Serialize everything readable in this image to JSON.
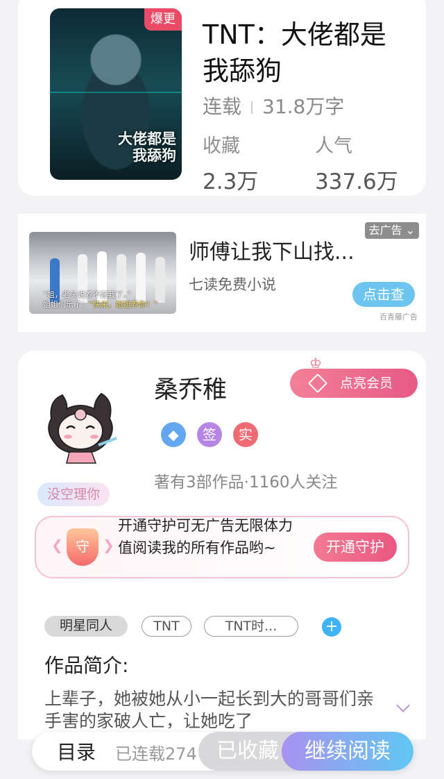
{
  "book": {
    "cover_badge": "爆更",
    "cover_title": "大佬都是我舔狗",
    "title": "TNT：大佬都是我舔狗",
    "status": "连载",
    "word_count": "31.8万字",
    "favorites_label": "收藏",
    "favorites_value": "2.3万",
    "popularity_label": "人气",
    "popularity_value": "337.6万"
  },
  "ad": {
    "title": "师傅让我下山找...",
    "source": "七读免费小说",
    "close_label": "去广告 ⌄",
    "cta_label": "点击查",
    "mark": "百青藤广告",
    "image_caption_1": "“姐，老头说养不起我了。”",
    "image_caption_2a": "姐姐们乐了：",
    "image_caption_2b": "“快来，姐姐养你！”"
  },
  "author": {
    "name": "桑乔稚",
    "vip_label": "点亮会员",
    "badges": [
      "签",
      "实"
    ],
    "stats": "著有3部作品·1160人关注",
    "busy_tag": "没空理你",
    "guard_icon": "守",
    "guard_text": "开通守护可无广告无限体力值阅读我的所有作品哟~",
    "guard_button": "开通守护"
  },
  "tags": [
    "明星同人",
    "TNT",
    "TNT时..."
  ],
  "intro": {
    "label": "作品简介:",
    "text": "上辈子，她被她从小一起长到大的哥哥们亲手害的家破人亡，让她吃了"
  },
  "bottom_bar": {
    "toc_label": "目录",
    "serial_label": "已连载274",
    "fav_label": "已收藏",
    "read_label": "继续阅读"
  },
  "colors": {
    "badge_red": "#e94b66",
    "vip_pink": "#e65a86",
    "tag_add_blue": "#3fb4f4",
    "read_gradient_start": "#a892f0",
    "read_gradient_end": "#5fc7f3"
  }
}
